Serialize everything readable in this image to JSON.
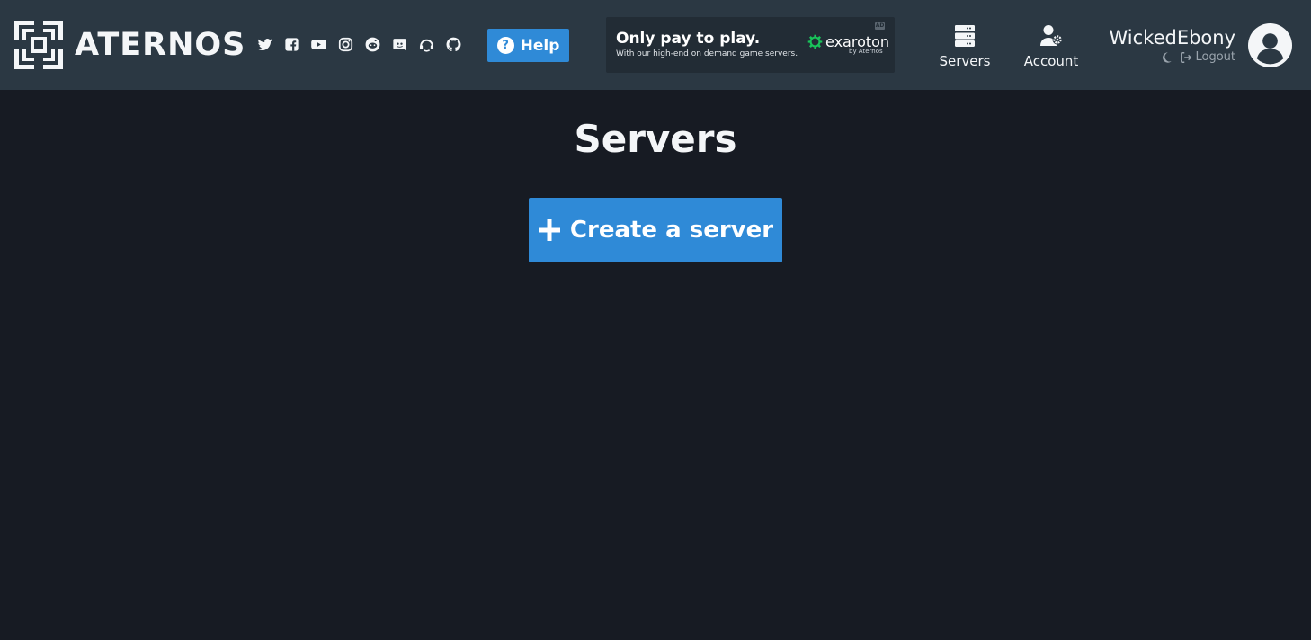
{
  "header": {
    "logo_text": "ATERNOS",
    "socials": [
      {
        "icon": "twitter-icon"
      },
      {
        "icon": "facebook-icon"
      },
      {
        "icon": "youtube-icon"
      },
      {
        "icon": "instagram-icon"
      },
      {
        "icon": "reddit-icon"
      },
      {
        "icon": "discord-icon"
      },
      {
        "icon": "teamspeak-icon"
      },
      {
        "icon": "github-icon"
      }
    ],
    "help_label": "Help",
    "ad": {
      "title": "Only pay to play.",
      "subtitle": "With our high-end on demand game servers.",
      "badge": "AD",
      "brand": "exaroton",
      "brand_by": "by Aternos"
    },
    "nav": {
      "servers_label": "Servers",
      "account_label": "Account"
    },
    "user": {
      "name": "WickedEbony",
      "logout_label": "Logout"
    }
  },
  "main": {
    "title": "Servers",
    "create_label": "Create a server"
  },
  "colors": {
    "header_bg": "#2b3843",
    "page_bg": "#171b23",
    "accent": "#2f8ad7",
    "brand_green": "#19c45a"
  }
}
